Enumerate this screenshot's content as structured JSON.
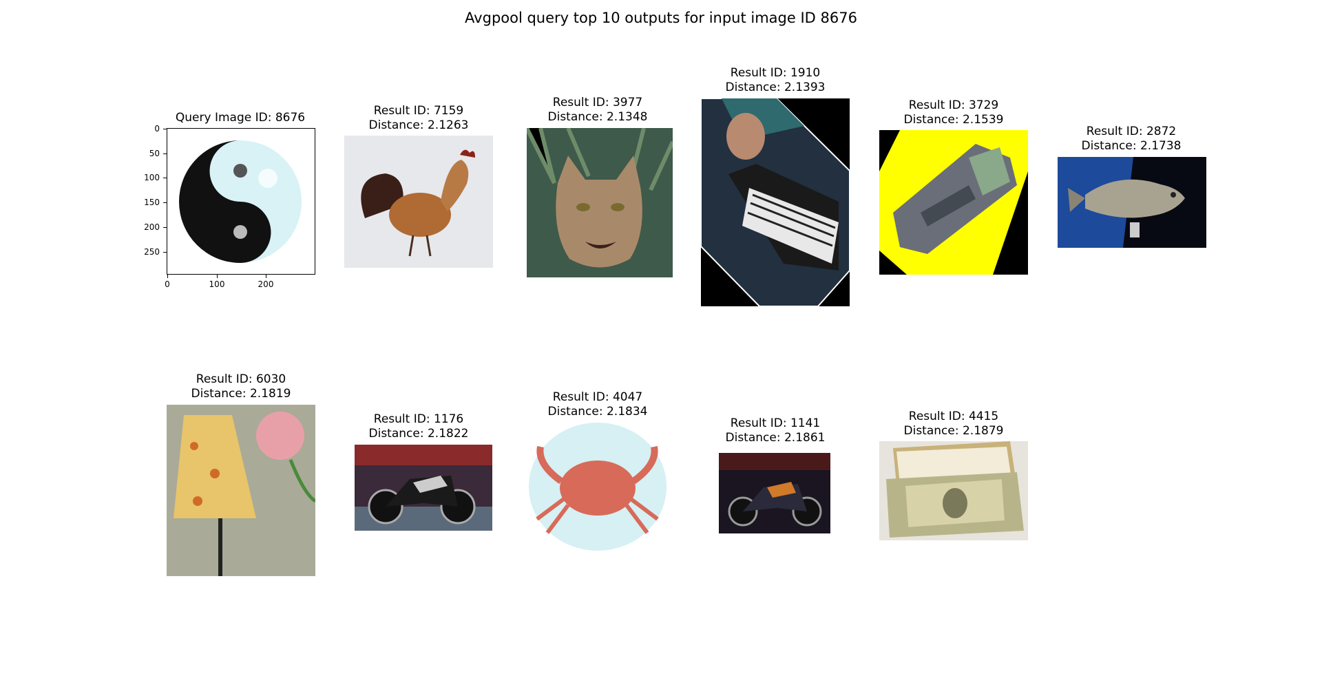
{
  "figure": {
    "title": "Avgpool query top 10 outputs for input image ID 8676"
  },
  "query": {
    "caption": "Query Image ID: 8676",
    "y_ticks": [
      "0",
      "50",
      "100",
      "150",
      "200",
      "250"
    ],
    "x_ticks": [
      "0",
      "100",
      "200"
    ],
    "icon": "yin-yang-image"
  },
  "results": [
    {
      "line1": "Result ID: 7159",
      "line2": "Distance: 2.1263",
      "icon": "rooster-image"
    },
    {
      "line1": "Result ID: 3977",
      "line2": "Distance: 2.1348",
      "icon": "cougar-image"
    },
    {
      "line1": "Result ID: 1910",
      "line2": "Distance: 2.1393",
      "icon": "accordion-player-image"
    },
    {
      "line1": "Result ID: 3729",
      "line2": "Distance: 2.1539",
      "icon": "cell-phone-image"
    },
    {
      "line1": "Result ID: 2872",
      "line2": "Distance: 2.1738",
      "icon": "fish-image"
    },
    {
      "line1": "Result ID: 6030",
      "line2": "Distance: 2.1819",
      "icon": "lamp-image"
    },
    {
      "line1": "Result ID: 1176",
      "line2": "Distance: 2.1822",
      "icon": "motorbike-image"
    },
    {
      "line1": "Result ID: 4047",
      "line2": "Distance: 2.1834",
      "icon": "crab-image"
    },
    {
      "line1": "Result ID: 1141",
      "line2": "Distance: 2.1861",
      "icon": "motorbike-image"
    },
    {
      "line1": "Result ID: 4415",
      "line2": "Distance: 2.1879",
      "icon": "dollar-bill-image"
    }
  ]
}
